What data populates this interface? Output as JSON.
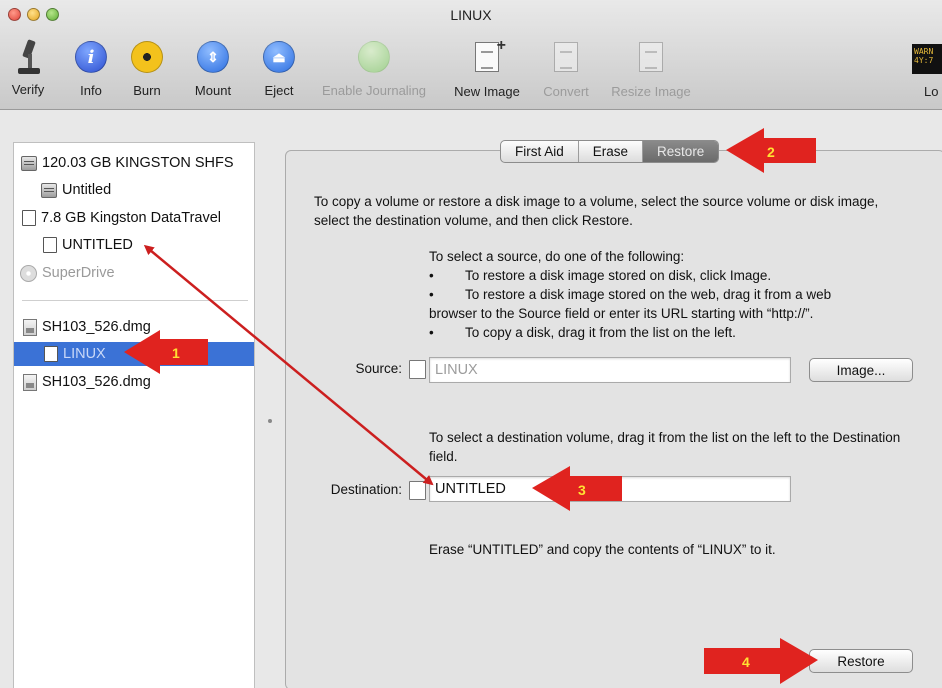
{
  "window": {
    "title": "LINUX"
  },
  "colors": {
    "selection": "#3b72d6",
    "arrow": "#cc1f1f",
    "marker_text": "#ffe133"
  },
  "toolbar": {
    "items": [
      {
        "label": "Verify",
        "icon": "microscope-icon",
        "enabled": true
      },
      {
        "label": "Info",
        "icon": "info-icon",
        "enabled": true
      },
      {
        "label": "Burn",
        "icon": "burn-icon",
        "enabled": true
      },
      {
        "label": "Mount",
        "icon": "mount-icon",
        "enabled": true
      },
      {
        "label": "Eject",
        "icon": "eject-icon",
        "enabled": true
      },
      {
        "label": "Enable Journaling",
        "icon": "journaling-icon",
        "enabled": false
      },
      {
        "label": "New Image",
        "icon": "new-image-icon",
        "enabled": true
      },
      {
        "label": "Convert",
        "icon": "convert-icon",
        "enabled": false
      },
      {
        "label": "Resize Image",
        "icon": "resize-image-icon",
        "enabled": false
      }
    ],
    "log_label": "Lo",
    "log_icon_text": "WARN\n4Y:7"
  },
  "sidebar": {
    "items": [
      {
        "label": "120.03 GB KINGSTON SHFS",
        "icon": "hard-disk-icon"
      },
      {
        "label": "Untitled",
        "icon": "hard-disk-icon"
      },
      {
        "label": "7.8 GB Kingston DataTravel",
        "icon": "volume-icon"
      },
      {
        "label": "UNTITLED",
        "icon": "volume-icon"
      },
      {
        "label": "SuperDrive",
        "icon": "optical-drive-icon"
      },
      {
        "label": "SH103_526.dmg",
        "icon": "disk-image-icon"
      },
      {
        "label": "LINUX",
        "icon": "volume-icon"
      },
      {
        "label": "SH103_526.dmg",
        "icon": "disk-image-icon"
      }
    ]
  },
  "tabs": [
    {
      "label": "First Aid",
      "active": false
    },
    {
      "label": "Erase",
      "active": false
    },
    {
      "label": "Restore",
      "active": true
    }
  ],
  "restore": {
    "intro": "To copy a volume or restore a disk image to a volume, select the source volume or disk image, select the destination volume, and then click Restore.",
    "source_heading": "To select a source, do one of the following:",
    "bullets": [
      "To restore a disk image stored on disk, click Image.",
      "To restore a disk image stored on the web, drag it from a web",
      "To copy a disk, drag it from the list on the left."
    ],
    "bullet_continuation": "browser to the Source field or enter its URL starting with “http://”.",
    "bullet_char": "•",
    "source_label": "Source:",
    "source_value": "LINUX",
    "image_button": "Image...",
    "destination_help": "To select a destination volume, drag it from the list on the left to the Destination field.",
    "destination_label": "Destination:",
    "destination_value": "UNTITLED",
    "summary": "Erase “UNTITLED” and copy the contents of “LINUX” to it.",
    "restore_button": "Restore"
  },
  "annotations": {
    "markers": [
      {
        "number": "1"
      },
      {
        "number": "2"
      },
      {
        "number": "3"
      },
      {
        "number": "4"
      }
    ]
  }
}
